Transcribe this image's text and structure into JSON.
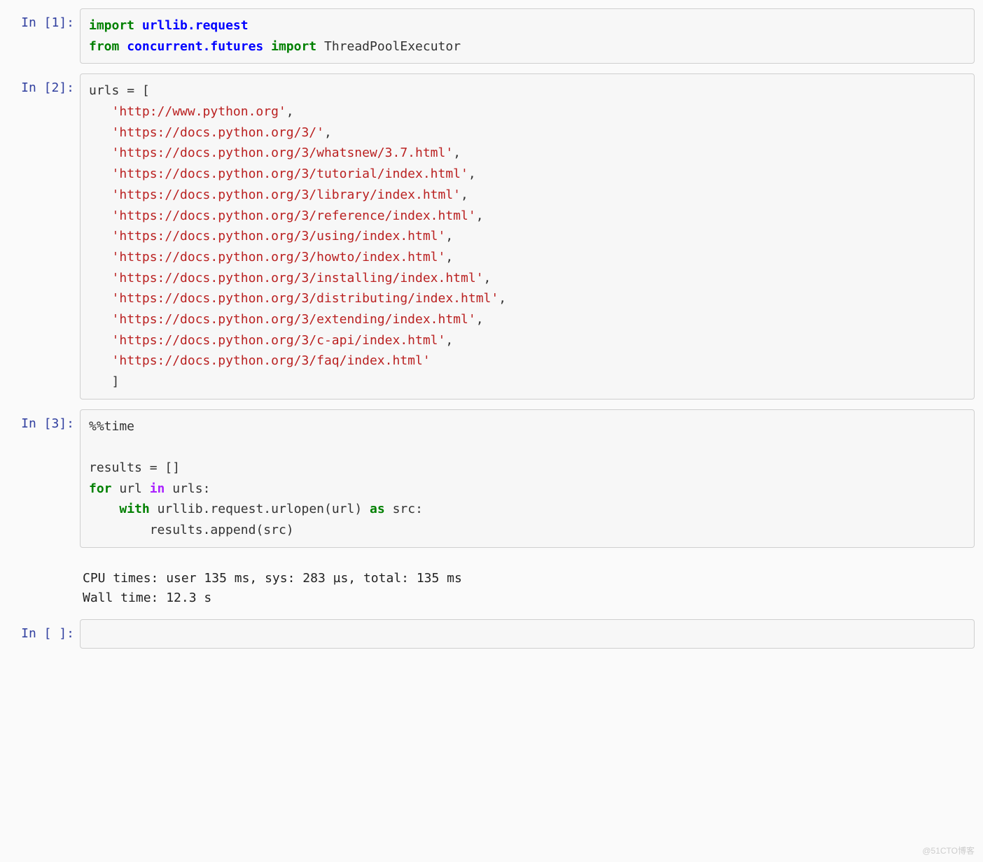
{
  "cells": [
    {
      "prompt": "In [1]:",
      "code": {
        "tokens": [
          {
            "t": "import",
            "cls": "kw-green"
          },
          {
            "t": " "
          },
          {
            "t": "urllib.request",
            "cls": "kw-blue"
          },
          {
            "t": "\n"
          },
          {
            "t": "from",
            "cls": "kw-green"
          },
          {
            "t": " "
          },
          {
            "t": "concurrent.futures",
            "cls": "kw-blue"
          },
          {
            "t": " "
          },
          {
            "t": "import",
            "cls": "kw-green"
          },
          {
            "t": " "
          },
          {
            "t": "ThreadPoolExecutor",
            "cls": "name"
          }
        ]
      }
    },
    {
      "prompt": "In [2]:",
      "code": {
        "tokens": [
          {
            "t": "urls",
            "cls": "name"
          },
          {
            "t": " = [",
            "cls": "punct"
          },
          {
            "t": "\n"
          },
          {
            "t": "   "
          },
          {
            "t": "'http://www.python.org'",
            "cls": "str"
          },
          {
            "t": ",",
            "cls": "punct"
          },
          {
            "t": "\n"
          },
          {
            "t": "   "
          },
          {
            "t": "'https://docs.python.org/3/'",
            "cls": "str"
          },
          {
            "t": ",",
            "cls": "punct"
          },
          {
            "t": "\n"
          },
          {
            "t": "   "
          },
          {
            "t": "'https://docs.python.org/3/whatsnew/3.7.html'",
            "cls": "str"
          },
          {
            "t": ",",
            "cls": "punct"
          },
          {
            "t": "\n"
          },
          {
            "t": "   "
          },
          {
            "t": "'https://docs.python.org/3/tutorial/index.html'",
            "cls": "str"
          },
          {
            "t": ",",
            "cls": "punct"
          },
          {
            "t": "\n"
          },
          {
            "t": "   "
          },
          {
            "t": "'https://docs.python.org/3/library/index.html'",
            "cls": "str"
          },
          {
            "t": ",",
            "cls": "punct"
          },
          {
            "t": "\n"
          },
          {
            "t": "   "
          },
          {
            "t": "'https://docs.python.org/3/reference/index.html'",
            "cls": "str"
          },
          {
            "t": ",",
            "cls": "punct"
          },
          {
            "t": "\n"
          },
          {
            "t": "   "
          },
          {
            "t": "'https://docs.python.org/3/using/index.html'",
            "cls": "str"
          },
          {
            "t": ",",
            "cls": "punct"
          },
          {
            "t": "\n"
          },
          {
            "t": "   "
          },
          {
            "t": "'https://docs.python.org/3/howto/index.html'",
            "cls": "str"
          },
          {
            "t": ",",
            "cls": "punct"
          },
          {
            "t": "\n"
          },
          {
            "t": "   "
          },
          {
            "t": "'https://docs.python.org/3/installing/index.html'",
            "cls": "str"
          },
          {
            "t": ",",
            "cls": "punct"
          },
          {
            "t": "\n"
          },
          {
            "t": "   "
          },
          {
            "t": "'https://docs.python.org/3/distributing/index.html'",
            "cls": "str"
          },
          {
            "t": ",",
            "cls": "punct"
          },
          {
            "t": "\n"
          },
          {
            "t": "   "
          },
          {
            "t": "'https://docs.python.org/3/extending/index.html'",
            "cls": "str"
          },
          {
            "t": ",",
            "cls": "punct"
          },
          {
            "t": "\n"
          },
          {
            "t": "   "
          },
          {
            "t": "'https://docs.python.org/3/c-api/index.html'",
            "cls": "str"
          },
          {
            "t": ",",
            "cls": "punct"
          },
          {
            "t": "\n"
          },
          {
            "t": "   "
          },
          {
            "t": "'https://docs.python.org/3/faq/index.html'",
            "cls": "str"
          },
          {
            "t": "\n"
          },
          {
            "t": "   ]",
            "cls": "punct"
          }
        ]
      }
    },
    {
      "prompt": "In [3]:",
      "code": {
        "tokens": [
          {
            "t": "%%time",
            "cls": "name"
          },
          {
            "t": "\n"
          },
          {
            "t": "\n"
          },
          {
            "t": "results",
            "cls": "name"
          },
          {
            "t": " = []",
            "cls": "punct"
          },
          {
            "t": "\n"
          },
          {
            "t": "for",
            "cls": "kw-green"
          },
          {
            "t": " "
          },
          {
            "t": "url",
            "cls": "name"
          },
          {
            "t": " "
          },
          {
            "t": "in",
            "cls": "kw-purple"
          },
          {
            "t": " "
          },
          {
            "t": "urls",
            "cls": "name"
          },
          {
            "t": ":",
            "cls": "punct"
          },
          {
            "t": "\n"
          },
          {
            "t": "    "
          },
          {
            "t": "with",
            "cls": "kw-green"
          },
          {
            "t": " "
          },
          {
            "t": "urllib",
            "cls": "name"
          },
          {
            "t": ".",
            "cls": "punct"
          },
          {
            "t": "request",
            "cls": "name"
          },
          {
            "t": ".",
            "cls": "punct"
          },
          {
            "t": "urlopen",
            "cls": "name"
          },
          {
            "t": "(",
            "cls": "punct"
          },
          {
            "t": "url",
            "cls": "name"
          },
          {
            "t": ")",
            "cls": "punct"
          },
          {
            "t": " "
          },
          {
            "t": "as",
            "cls": "kw-green"
          },
          {
            "t": " "
          },
          {
            "t": "src",
            "cls": "name"
          },
          {
            "t": ":",
            "cls": "punct"
          },
          {
            "t": "\n"
          },
          {
            "t": "        "
          },
          {
            "t": "results",
            "cls": "name"
          },
          {
            "t": ".",
            "cls": "punct"
          },
          {
            "t": "append",
            "cls": "name"
          },
          {
            "t": "(",
            "cls": "punct"
          },
          {
            "t": "src",
            "cls": "name"
          },
          {
            "t": ")",
            "cls": "punct"
          }
        ]
      },
      "output": "CPU times: user 135 ms, sys: 283 µs, total: 135 ms\nWall time: 12.3 s"
    },
    {
      "prompt": "In [ ]:",
      "code": {
        "tokens": []
      }
    }
  ],
  "watermark": "@51CTO博客"
}
